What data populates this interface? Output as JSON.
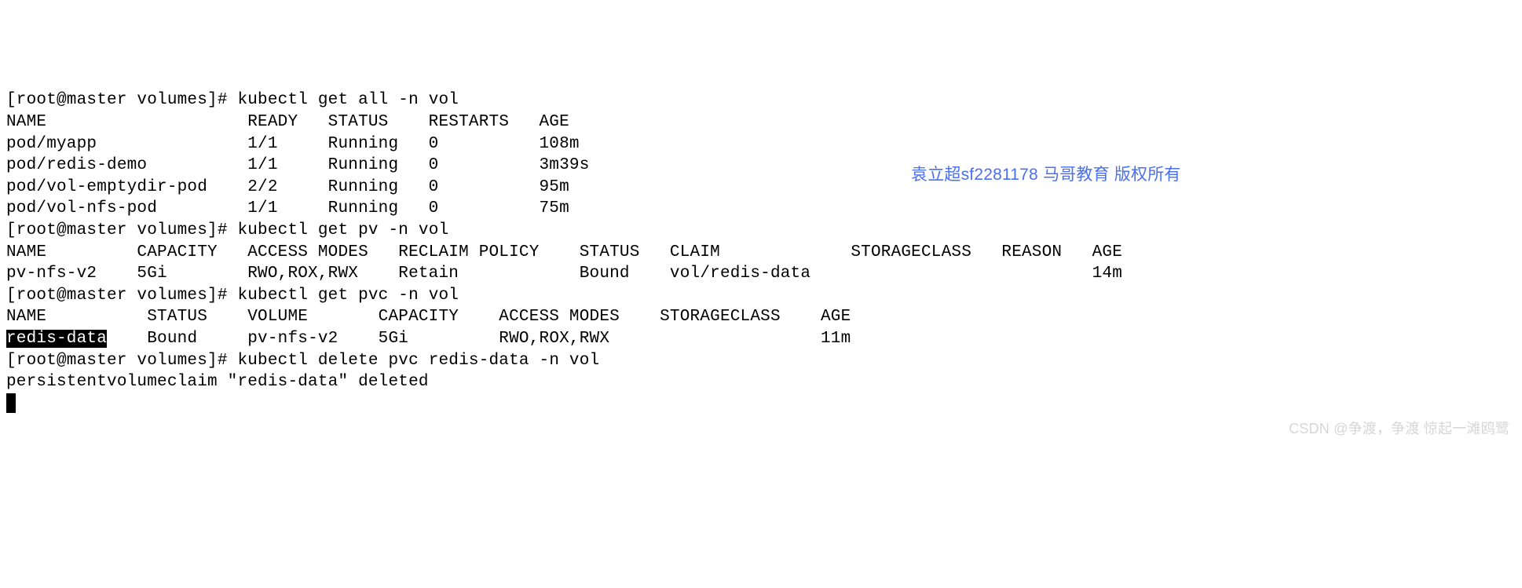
{
  "cmd1": {
    "prompt": "[root@master volumes]# ",
    "command": "kubectl get all -n vol",
    "header": "NAME                    READY   STATUS    RESTARTS   AGE",
    "rows": [
      "pod/myapp               1/1     Running   0          108m",
      "pod/redis-demo          1/1     Running   0          3m39s",
      "pod/vol-emptydir-pod    2/2     Running   0          95m",
      "pod/vol-nfs-pod         1/1     Running   0          75m"
    ]
  },
  "cmd2": {
    "prompt": "[root@master volumes]# ",
    "command": "kubectl get pv -n vol",
    "header": "NAME         CAPACITY   ACCESS MODES   RECLAIM POLICY    STATUS   CLAIM             STORAGECLASS   REASON   AGE",
    "rows": [
      "pv-nfs-v2    5Gi        RWO,ROX,RWX    Retain            Bound    vol/redis-data                            14m"
    ]
  },
  "cmd3": {
    "prompt": "[root@master volumes]# ",
    "command": "kubectl get pvc -n vol",
    "header": "NAME          STATUS    VOLUME       CAPACITY    ACCESS MODES    STORAGECLASS    AGE",
    "selected": "redis-data",
    "rest": "    Bound     pv-nfs-v2    5Gi         RWO,ROX,RWX                     11m"
  },
  "cmd4": {
    "prompt": "[root@master volumes]# ",
    "command": "kubectl delete pvc redis-data -n vol",
    "output": "persistentvolumeclaim \"redis-data\" deleted"
  },
  "wm1": "袁立超sf2281178 马哥教育 版权所有",
  "wm2": "CSDN @争渡，争渡 惊起一滩鸥鹭"
}
